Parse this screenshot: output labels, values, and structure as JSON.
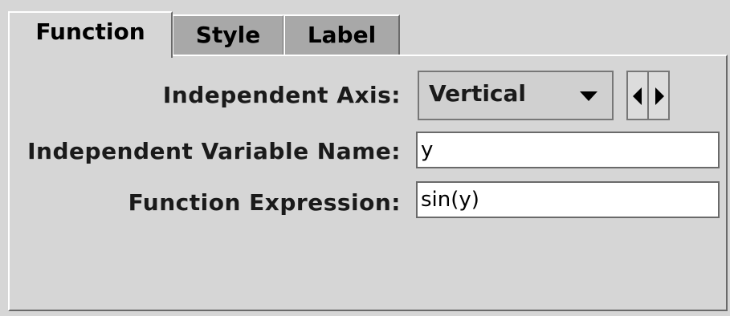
{
  "tabs": [
    {
      "label": "Function",
      "active": true
    },
    {
      "label": "Style",
      "active": false
    },
    {
      "label": "Label",
      "active": false
    }
  ],
  "form": {
    "independent_axis_label": "Independent Axis:",
    "independent_axis_value": "Vertical",
    "variable_name_label": "Independent Variable Name:",
    "variable_name_value": "y",
    "expression_label": "Function Expression:",
    "expression_value": "sin(y)"
  },
  "icons": {
    "dropdown": "chevron-down-icon",
    "prev": "arrow-left-icon",
    "next": "arrow-right-icon"
  },
  "colors": {
    "background": "#d6d6d6",
    "inactive_tab": "#a8a8a8",
    "field_background": "#ffffff"
  }
}
